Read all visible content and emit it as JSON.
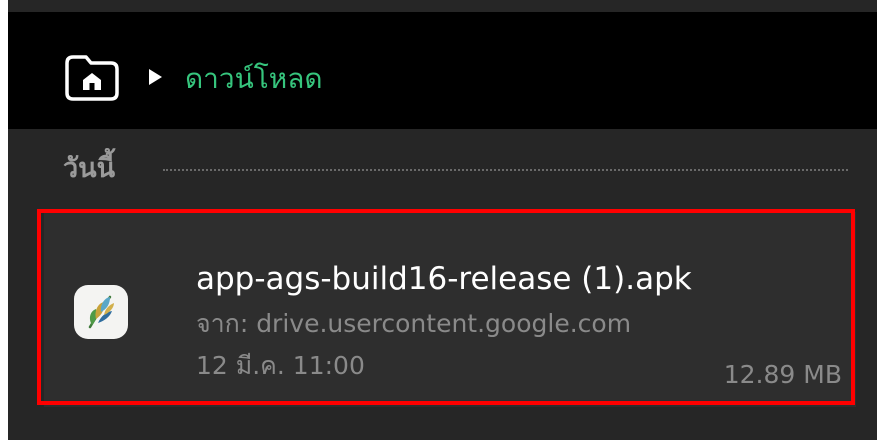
{
  "header": {
    "home_icon": "folder-home-icon",
    "separator_icon": "play-arrow-icon",
    "current_folder": "ดาวน์โหลด"
  },
  "section": {
    "title": "วันนี้"
  },
  "file": {
    "icon": "wheat-app-icon",
    "name": "app-ags-build16-release (1).apk",
    "source": "จาก: drive.usercontent.google.com",
    "date": "12 มี.ค. 11:00",
    "size": "12.89 MB"
  },
  "colors": {
    "header_background": "#000000",
    "list_background": "#262626",
    "breadcrumb_accent": "#36c57d",
    "highlight_border": "#ff0000",
    "secondary_text": "#8a8a8a"
  }
}
